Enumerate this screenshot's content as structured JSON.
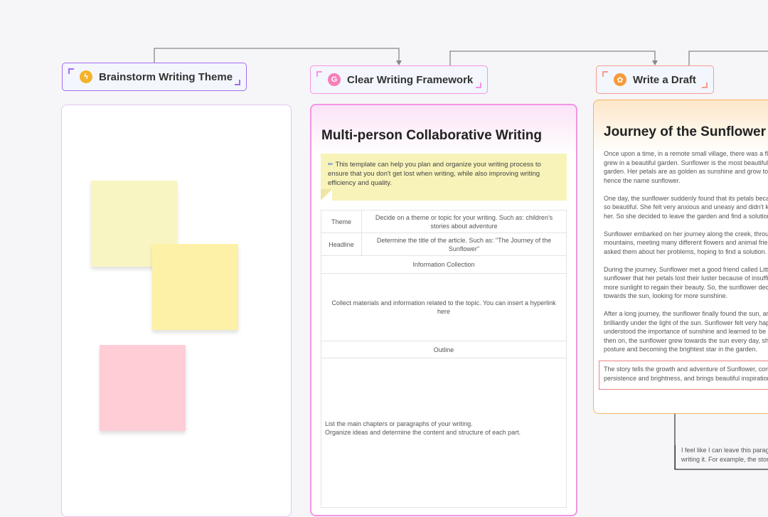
{
  "nodes": [
    {
      "title": "Brainstorm Writing Theme",
      "icon": "lightbulb-icon",
      "border_color": "#a46cf0"
    },
    {
      "title": "Clear Writing Framework",
      "icon": "medal-icon",
      "border_color": "#f494e4"
    },
    {
      "title": "Write a Draft",
      "icon": "sunflower-icon",
      "border_color": "#f79c8e"
    }
  ],
  "brainstorm": {
    "sticky_notes": [
      {
        "color": "#f8f5c2"
      },
      {
        "color": "#fcf1a6"
      },
      {
        "color": "#fecdd5"
      }
    ]
  },
  "framework": {
    "title": "Multi-person Collaborative Writing",
    "callout_icon": "✏",
    "callout_text": "This template can help you plan and organize your writing process to ensure that you don't get lost when writing, while also improving writing efficiency and quality.",
    "rows": [
      {
        "label": "Theme",
        "value": "Decide on a theme or topic for your writing. Such as: children's stories about adventure"
      },
      {
        "label": "Headline",
        "value": "Determine the title of the article. Such as: \"The Journey of the Sunflower\""
      }
    ],
    "info_heading": "Information Collection",
    "info_text": "Collect materials and information related to the topic. You can insert a hyperlink here",
    "outline_heading": "Outline",
    "outline_line1": "List the main chapters or paragraphs of your writing.",
    "outline_line2": "Organize ideas and determine the content and structure of each part."
  },
  "draft": {
    "title": "Journey of the Sunflower",
    "paragraphs": [
      [
        "Once upon a time, in a remote small village, there was a flo",
        "grew in a beautiful garden. Sunflower is the most beautiful",
        "garden. Her petals are as golden as sunshine and grow tow",
        "hence the name sunflower."
      ],
      [
        "One day, the sunflower suddenly found that its petals becar",
        "so beautiful. She felt very anxious and uneasy and didn't kn",
        "her. So she decided to leave the garden and find a solution."
      ],
      [
        "Sunflower embarked on her journey along the creek, throu",
        "mountains, meeting many different flowers and animal frie",
        "asked them about her problems, hoping to find a solution."
      ],
      [
        "During the journey, Sunflower met a good friend called Litt",
        "sunflower that her petals lost their luster because of insuffi",
        "more sunlight to regain their beauty. So, the sunflower deci",
        "towards the sun, looking for more sunshine."
      ],
      [
        "After a long journey, the sunflower finally found the sun, an",
        "brilliantly under the light of the sun. Sunflower felt very hap",
        "understood the importance of sunshine and learned to be p",
        "then on, the sunflower grew towards the sun every day, sho",
        "posture and becoming the brightest star in the garden."
      ]
    ],
    "highlight_lines": [
      "The story tells the growth and adventure of Sunflower, con",
      "persistence and brightness, and brings beautiful inspiration"
    ],
    "comment_lines": [
      "I feel like I can leave this paragra",
      "writing it. For example, the story"
    ]
  }
}
